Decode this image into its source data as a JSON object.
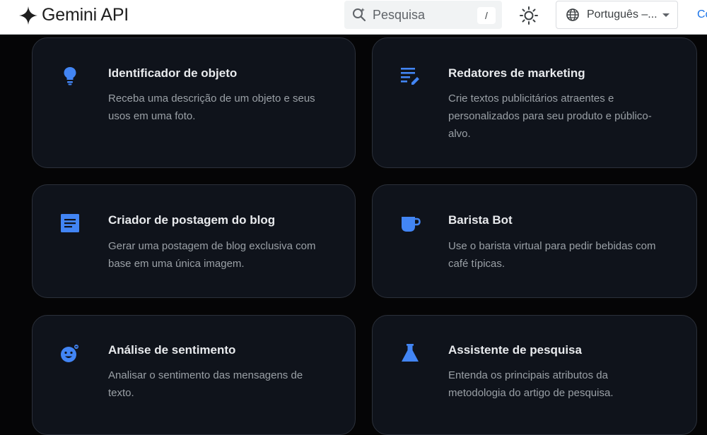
{
  "header": {
    "title": "Gemini API",
    "search_placeholder": "Pesquisa",
    "search_shortcut": "/",
    "language": "Português –...",
    "edge_link": "Co"
  },
  "cards": [
    {
      "title": "Identificador de objeto",
      "description": "Receba uma descrição de um objeto e seus usos em uma foto.",
      "icon": "lightbulb-icon"
    },
    {
      "title": "Redatores de marketing",
      "description": "Crie textos publicitários atraentes e personalizados para seu produto e público-alvo.",
      "icon": "edit-note-icon"
    },
    {
      "title": "Criador de postagem do blog",
      "description": "Gerar uma postagem de blog exclusiva com base em uma única imagem.",
      "icon": "article-icon"
    },
    {
      "title": "Barista Bot",
      "description": "Use o barista virtual para pedir bebidas com café típicas.",
      "icon": "coffee-cup-icon"
    },
    {
      "title": "Análise de sentimento",
      "description": "Analisar o sentimento das mensagens de texto.",
      "icon": "sentiment-emoji-icon"
    },
    {
      "title": "Assistente de pesquisa",
      "description": "Entenda os principais atributos da metodologia do artigo de pesquisa.",
      "icon": "flask-icon"
    }
  ],
  "colors": {
    "accent": "#1a73e8",
    "icon_blue": "#4285f4",
    "card_background": "#0f131b",
    "page_background": "#050506"
  }
}
